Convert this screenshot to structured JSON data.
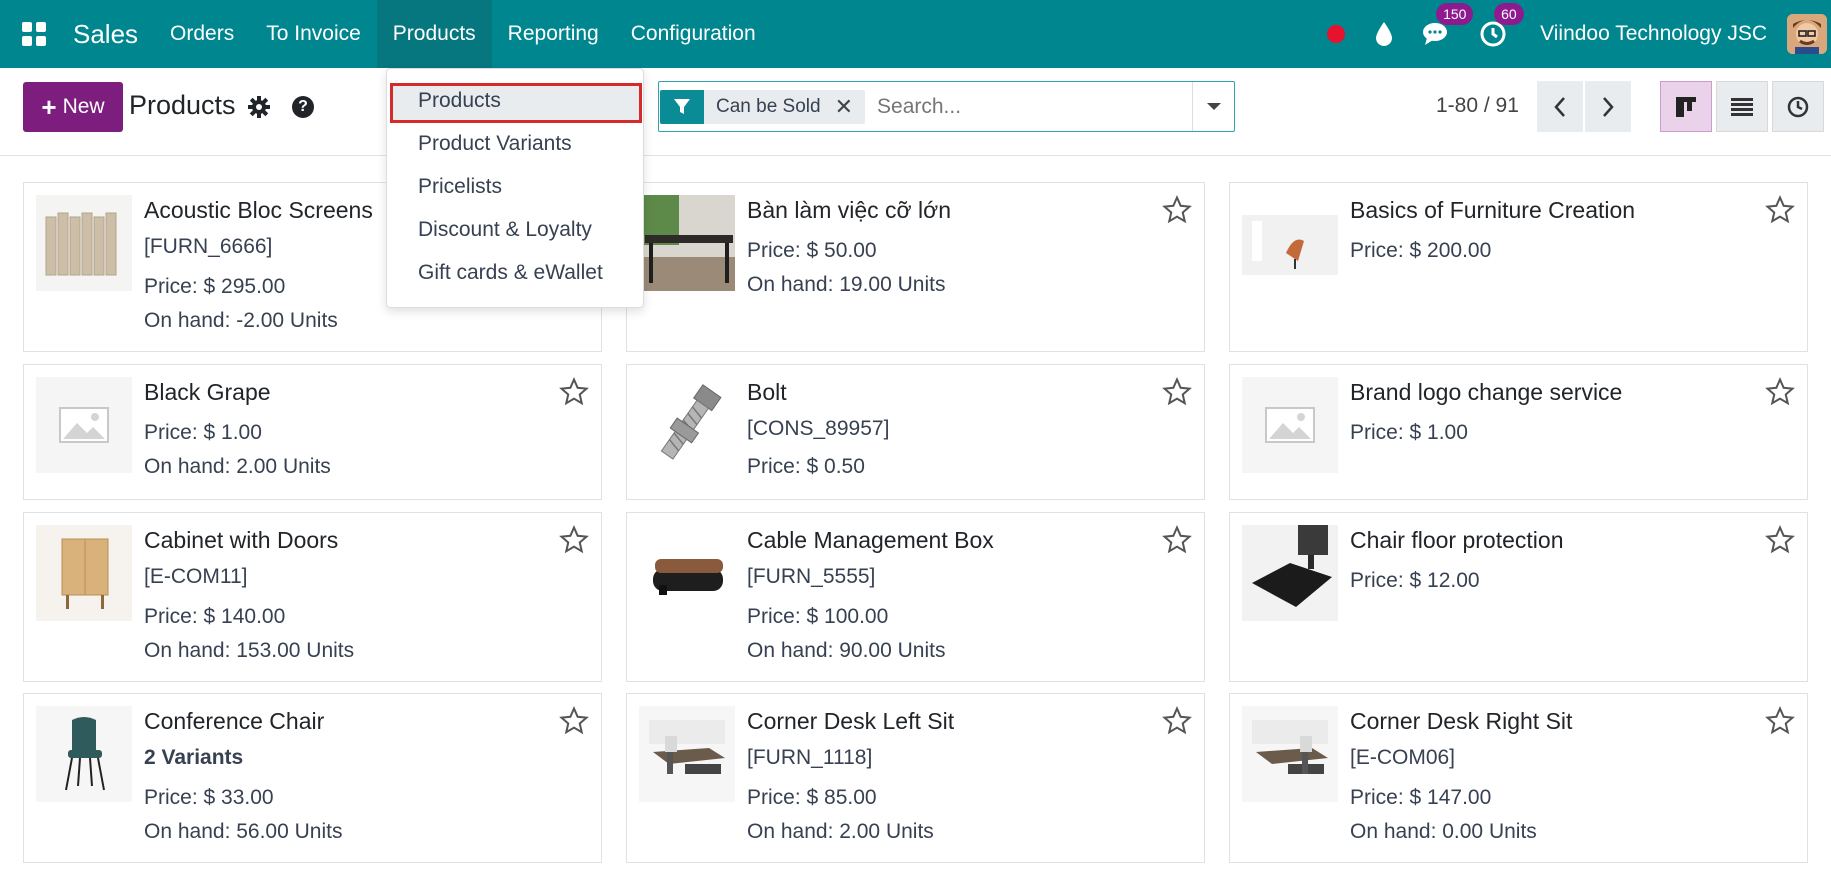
{
  "navbar": {
    "app_name": "Sales",
    "menu": [
      "Orders",
      "To Invoice",
      "Products",
      "Reporting",
      "Configuration"
    ],
    "messages_badge": "150",
    "activities_badge": "60",
    "company": "Viindoo Technology JSC"
  },
  "control": {
    "new_label": "New",
    "title": "Products",
    "facet_label": "Can be Sold",
    "search_placeholder": "Search...",
    "pager_value": "1-80 / 91"
  },
  "dropdown": {
    "items": [
      "Products",
      "Product Variants",
      "Pricelists",
      "Discount & Loyalty",
      "Gift cards & eWallet"
    ]
  },
  "products": [
    {
      "name": "Acoustic Bloc Screens",
      "ref": "[FURN_6666]",
      "price": "Price: $ 295.00",
      "onhand": "On hand: -2.00 Units",
      "image": "acoustic-screen-image"
    },
    {
      "name": "Bàn làm việc cỡ lớn",
      "price": "Price: $ 50.00",
      "onhand": "On hand: 19.00 Units",
      "image": "large-desk-image"
    },
    {
      "name": "Basics of Furniture Creation",
      "price": "Price: $ 200.00",
      "image": "furniture-course-image"
    },
    {
      "name": "Black Grape",
      "price": "Price: $ 1.00",
      "onhand": "On hand: 2.00 Units",
      "image": "placeholder-image"
    },
    {
      "name": "Bolt",
      "ref": "[CONS_89957]",
      "price": "Price: $ 0.50",
      "image": "bolt-image"
    },
    {
      "name": "Brand logo change service",
      "price": "Price: $ 1.00",
      "image": "placeholder-image"
    },
    {
      "name": "Cabinet with Doors",
      "ref": "[E-COM11]",
      "price": "Price: $ 140.00",
      "onhand": "On hand: 153.00 Units",
      "image": "cabinet-image"
    },
    {
      "name": "Cable Management Box",
      "ref": "[FURN_5555]",
      "price": "Price: $ 100.00",
      "onhand": "On hand: 90.00 Units",
      "image": "cable-box-image"
    },
    {
      "name": "Chair floor protection",
      "price": "Price: $ 12.00",
      "image": "floor-mat-image"
    },
    {
      "name": "Conference Chair",
      "variants": "2 Variants",
      "price": "Price: $ 33.00",
      "onhand": "On hand: 56.00 Units",
      "image": "conference-chair-image"
    },
    {
      "name": "Corner Desk Left Sit",
      "ref": "[FURN_1118]",
      "price": "Price: $ 85.00",
      "onhand": "On hand: 2.00 Units",
      "image": "corner-desk-image"
    },
    {
      "name": "Corner Desk Right Sit",
      "ref": "[E-COM06]",
      "price": "Price: $ 147.00",
      "onhand": "On hand: 0.00 Units",
      "image": "corner-desk-image"
    }
  ]
}
